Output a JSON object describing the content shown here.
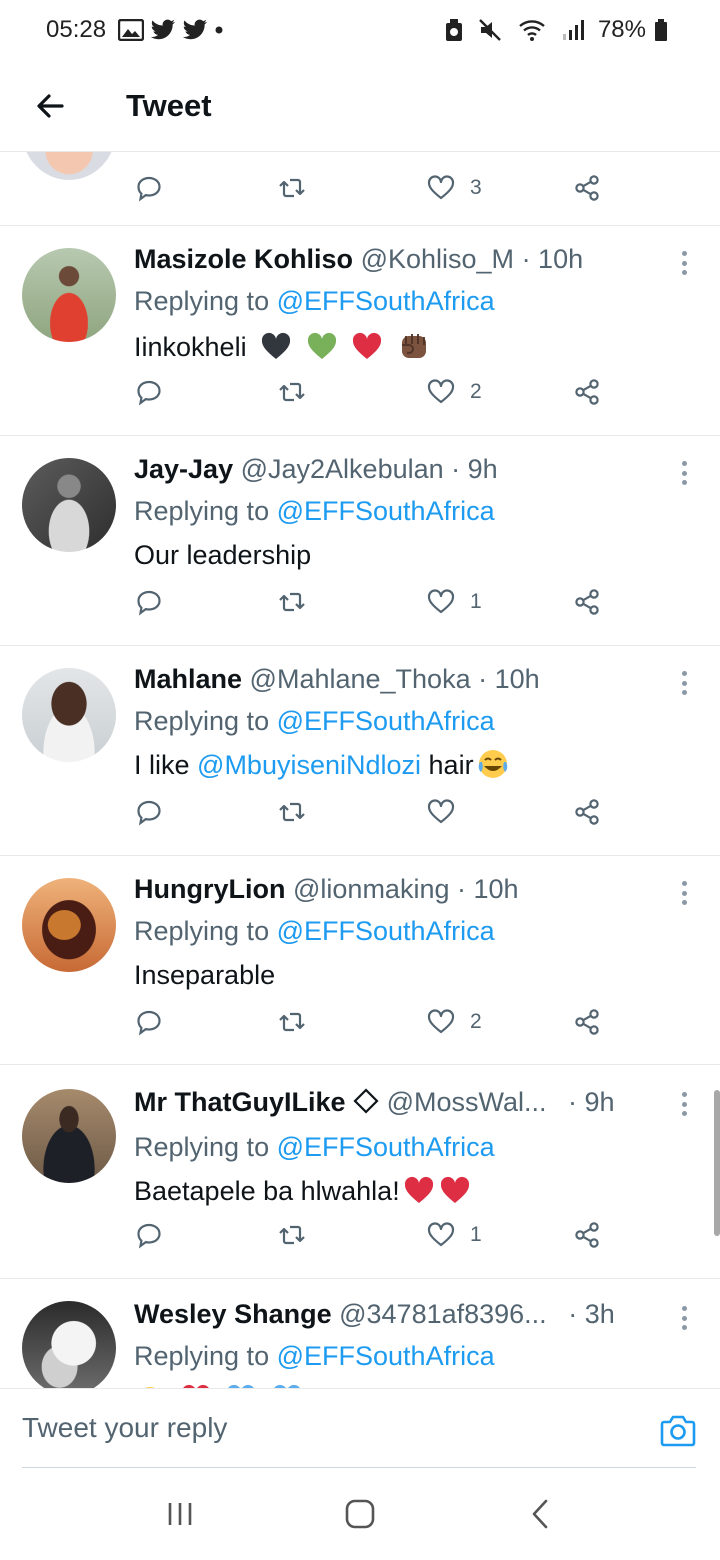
{
  "status_bar": {
    "time": "05:28",
    "battery": "78%"
  },
  "header": {
    "title": "Tweet"
  },
  "top_partial": {
    "like_count": "3"
  },
  "tweets": [
    {
      "name": "Masizole Kohliso",
      "handle": "@Kohliso_M",
      "time": "· 10h",
      "replying_prefix": "Replying to",
      "replying_to": "@EFFSouthAfrica",
      "text": "Iinkokheli",
      "text_mention": "",
      "text_after": "",
      "emojis": [
        "black-heart",
        "green-heart",
        "red-heart",
        "raised-fist"
      ],
      "like_count": "2"
    },
    {
      "name": "Jay-Jay",
      "handle": "@Jay2Alkebulan",
      "time": "· 9h",
      "replying_prefix": "Replying to",
      "replying_to": "@EFFSouthAfrica",
      "text": "Our leadership",
      "text_mention": "",
      "text_after": "",
      "emojis": [],
      "like_count": "1"
    },
    {
      "name": "Mahlane",
      "handle": "@Mahlane_Thoka",
      "time": "· 10h",
      "replying_prefix": "Replying to",
      "replying_to": "@EFFSouthAfrica",
      "text": "I like ",
      "text_mention": "@MbuyiseniNdlozi",
      "text_after": " hair",
      "emojis": [
        "joy-face"
      ],
      "like_count": ""
    },
    {
      "name": "HungryLion",
      "handle": "@lionmaking",
      "time": "· 10h",
      "replying_prefix": "Replying to",
      "replying_to": "@EFFSouthAfrica",
      "text": "Inseparable",
      "text_mention": "",
      "text_after": "",
      "emojis": [],
      "like_count": "2"
    },
    {
      "name": "Mr ThatGuyILike",
      "handle": "@MossWal...",
      "time": "· 9h",
      "replying_prefix": "Replying to",
      "replying_to": "@EFFSouthAfrica",
      "text": "Baetapele ba hlwahla!",
      "text_mention": "",
      "text_after": "",
      "emojis": [
        "red-heart",
        "red-heart"
      ],
      "like_count": "1"
    },
    {
      "name": "Wesley Shange",
      "handle": "@34781af8396...",
      "time": "· 3h",
      "replying_prefix": "Replying to",
      "replying_to": "@EFFSouthAfrica",
      "text": "",
      "text_mention": "",
      "text_after": "",
      "emojis": [],
      "like_count": ""
    }
  ],
  "compose": {
    "placeholder": "Tweet your reply"
  },
  "colors": {
    "accent": "#1d9bf0",
    "secondary_text": "#536471",
    "primary_text": "#0f1419"
  }
}
